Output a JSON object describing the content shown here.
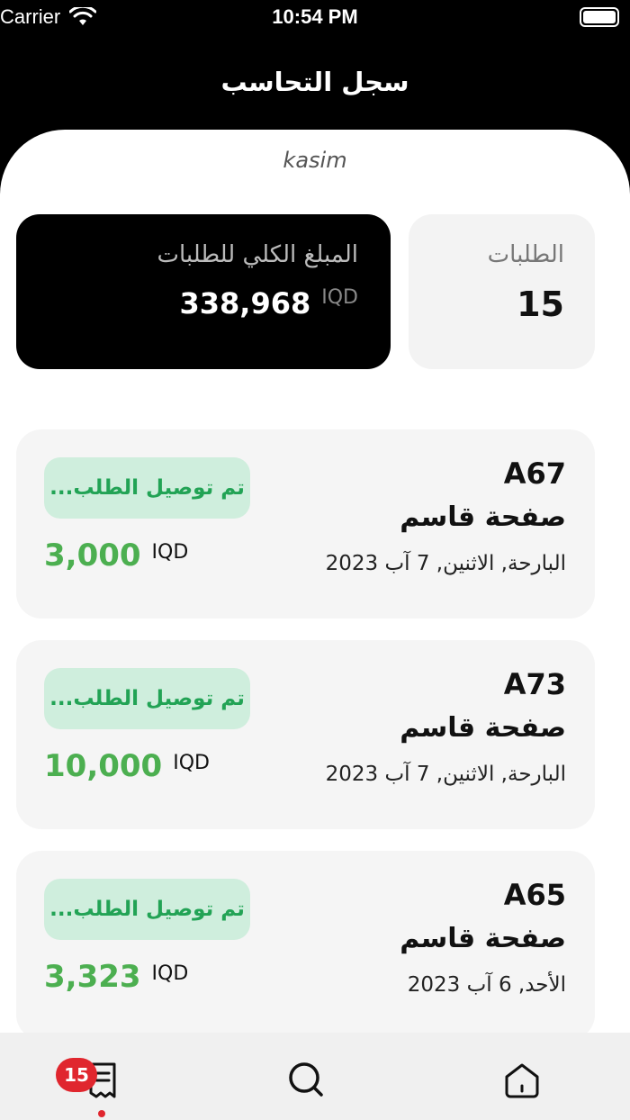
{
  "status_bar": {
    "carrier": "Carrier",
    "time": "10:54 PM"
  },
  "header": {
    "title": "سجل التحاسب"
  },
  "user": {
    "name": "kasim"
  },
  "summary": {
    "orders_label": "الطلبات",
    "orders_count": "15",
    "total_label": "المبلغ الكلي للطلبات",
    "total_amount": "338,968",
    "total_currency": "IQD"
  },
  "orders": [
    {
      "code": "A67",
      "shop": "صفحة قاسم",
      "date": "البارحة, الاثنين, 7 آب 2023",
      "status": "تم توصيل الطلب...",
      "price": "3,000",
      "currency": "IQD"
    },
    {
      "code": "A73",
      "shop": "صفحة قاسم",
      "date": "البارحة, الاثنين, 7 آب 2023",
      "status": "تم توصيل الطلب...",
      "price": "10,000",
      "currency": "IQD"
    },
    {
      "code": "A65",
      "shop": "صفحة قاسم",
      "date": "الأحد, 6 آب 2023",
      "status": "تم توصيل الطلب...",
      "price": "3,323",
      "currency": "IQD"
    }
  ],
  "tab_bar": {
    "orders_badge": "15",
    "tabs": [
      {
        "icon": "receipt-icon",
        "active": true
      },
      {
        "icon": "search-icon",
        "active": false
      },
      {
        "icon": "home-icon",
        "active": false
      }
    ]
  },
  "colors": {
    "accent_green": "#4caf50",
    "status_bg": "#cfeedd",
    "badge_red": "#e0262e"
  }
}
